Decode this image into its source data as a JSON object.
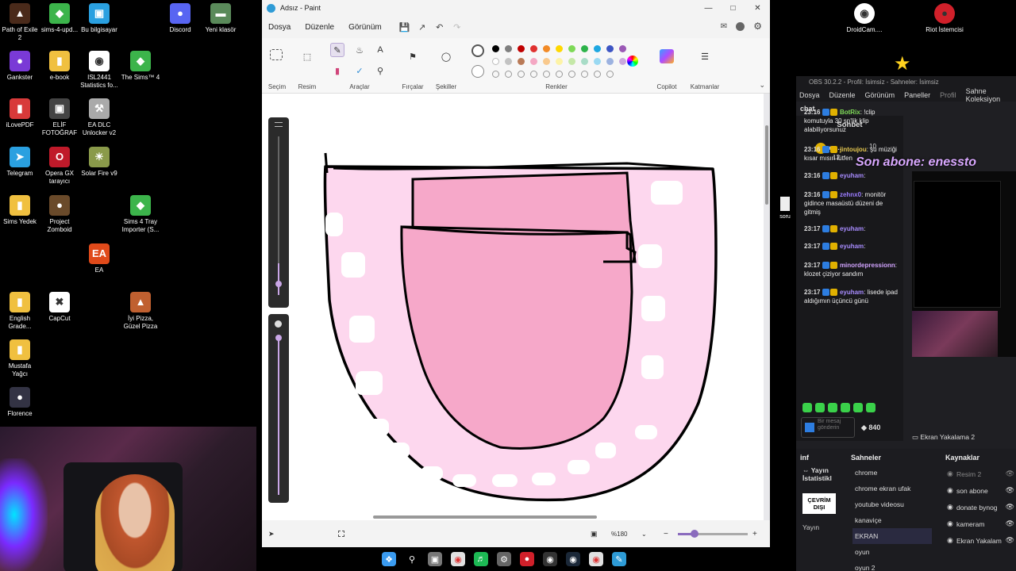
{
  "desktop": {
    "icons_col1": [
      {
        "label": "Path of Exile 2",
        "icon": "poe-icon"
      },
      {
        "label": "Gankster",
        "icon": "gankster-icon"
      },
      {
        "label": "iLovePDF",
        "icon": "pdf-icon"
      },
      {
        "label": "Telegram",
        "icon": "telegram-icon"
      },
      {
        "label": "Sims Yedek",
        "icon": "folder-icon"
      },
      {
        "label": "English Grade...",
        "icon": "folder-icon"
      },
      {
        "label": "Mustafa Yağcı",
        "icon": "folder-icon"
      },
      {
        "label": "Florence",
        "icon": "florence-icon"
      }
    ],
    "icons_col2": [
      {
        "label": "sims-4-upd...",
        "icon": "sims-icon"
      },
      {
        "label": "e-book",
        "icon": "folder-icon"
      },
      {
        "label": "ELİF FOTOĞRAF",
        "icon": "camera-icon"
      },
      {
        "label": "Opera GX tarayıcı",
        "icon": "opera-icon"
      },
      {
        "label": "Project Zomboid",
        "icon": "zomboid-icon"
      },
      {
        "label": "CapCut",
        "icon": "capcut-icon"
      }
    ],
    "icons_col3": [
      {
        "label": "Bu bilgisayar",
        "icon": "computer-icon"
      },
      {
        "label": "ISL2441 Statistics fo...",
        "icon": "chrome-icon"
      },
      {
        "label": "EA DLC Unlocker v2",
        "icon": "tool-icon"
      },
      {
        "label": "Solar Fire v9",
        "icon": "solar-icon"
      },
      {
        "label": "EA",
        "icon": "ea-icon"
      }
    ],
    "icons_col4": [
      {
        "label": "The Sims™ 4",
        "icon": "sims-icon"
      },
      {
        "label": "Sims 4 Tray Importer (S...",
        "icon": "sims-icon"
      },
      {
        "label": "İyi Pizza, Güzel Pizza",
        "icon": "pizza-icon"
      }
    ],
    "icons_col5": [
      {
        "label": "Discord",
        "icon": "discord-icon"
      },
      {
        "label": "Yeni klasör",
        "icon": "drive-icon"
      }
    ],
    "right_icons": [
      {
        "label": "DroidCam....",
        "icon": "droidcam-icon"
      },
      {
        "label": "Riot İstemcisi",
        "icon": "riot-icon"
      }
    ],
    "mini_icon_label": "soru",
    "overlay_text": "Son abone: enessto"
  },
  "paint": {
    "title": "Adsız - Paint",
    "menu": [
      "Dosya",
      "Düzenle",
      "Görünüm"
    ],
    "groups": {
      "selection": "Seçim",
      "image": "Resim",
      "tools": "Araçlar",
      "brushes": "Fırçalar",
      "shapes": "Şekiller",
      "colors": "Renkler",
      "copilot": "Copilot",
      "layers": "Katmanlar"
    },
    "palette_row1": [
      "#000000",
      "#7f7f7f",
      "#c00000",
      "#e0312f",
      "#f28a26",
      "#ffd800",
      "#7ed957",
      "#2db34a",
      "#1ea7e1",
      "#3d55c4",
      "#9b59b6"
    ],
    "palette_row2": [
      "#ffffff",
      "#c3c3c3",
      "#b97a57",
      "#f4a7c3",
      "#f9c98d",
      "#fdf3a6",
      "#c5e8a8",
      "#a8dcc7",
      "#9ad9f2",
      "#9cb2e0",
      "#c9a8dc"
    ],
    "zoom": "%180",
    "colors": {
      "gum": "#fdd7ee",
      "tongue": "#f6a8c9",
      "accent": "#8a6bbd"
    }
  },
  "taskbar": {
    "apps": [
      "windows-icon",
      "search-icon",
      "taskview-icon",
      "chrome-icon",
      "spotify-icon",
      "settings-icon",
      "riot-icon",
      "obs-icon",
      "steam-icon",
      "chrome-icon",
      "paint-icon"
    ]
  },
  "obs": {
    "title": "OBS 30.2.2 - Profil: İsimsiz - Sahneler: İsimsiz",
    "menu": [
      "Dosya",
      "Düzenle",
      "Görünüm",
      "Paneller",
      "Profil",
      "Sahne Koleksiyon"
    ],
    "chat_dock": "chat",
    "chat_header": "Sohbet",
    "top_user": "es...",
    "top_counts": [
      "10",
      "12"
    ],
    "messages": [
      {
        "time": "23:16",
        "user": "BotRix",
        "user_color": "#7ed957",
        "text": "!clip komutuyla 30 sn'lik klip alabiliyorsunuz"
      },
      {
        "time": "23:16",
        "user": "jintoujou",
        "user_color": "#e6c84f",
        "text": "şu müziği kısar mısın lütfen"
      },
      {
        "time": "23:16",
        "user": "eyuham",
        "user_color": "#a88cff",
        "text": ""
      },
      {
        "time": "23:16",
        "user": "zehnx0",
        "user_color": "#9b7cff",
        "text": "monitör gidince masaüstü düzeni de gitmiş"
      },
      {
        "time": "23:17",
        "user": "eyuham",
        "user_color": "#a88cff",
        "text": ""
      },
      {
        "time": "23:17",
        "user": "eyuham",
        "user_color": "#a88cff",
        "text": ""
      },
      {
        "time": "23:17",
        "user": "minordepressionn",
        "user_color": "#d2a4ff",
        "text": "klozet çiziyor sandım"
      },
      {
        "time": "23:17",
        "user": "eyuham",
        "user_color": "#a88cff",
        "text": "lisede ipad aldığımın üçüncü günü"
      }
    ],
    "send_placeholder": "Bir mesaj gönderin",
    "points": "840",
    "capture_label": "Ekran Yakalama 2",
    "stats_dock": "inf",
    "stats_label": "Yayın İstatistikl",
    "offline": "ÇEVRİM DIŞI",
    "stream_label": "Yayın",
    "scenes_header": "Sahneler",
    "scenes": [
      "chrome",
      "chrome ekran ufak",
      "youtube videosu",
      "kanaviçe",
      "EKRAN",
      "oyun",
      "oyun 2"
    ],
    "sources_header": "Kaynaklar",
    "sources": [
      "Resim 2",
      "son abone",
      "donate bynog",
      "kameram",
      "Ekran Yakalam"
    ]
  }
}
